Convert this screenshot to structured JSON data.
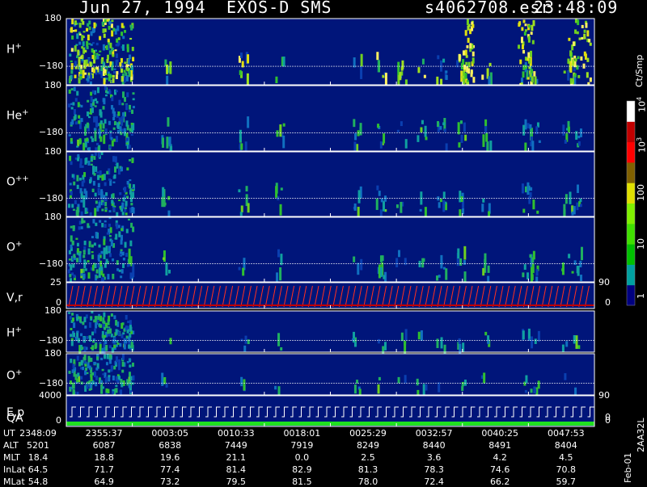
{
  "header": {
    "date": "Jun 27, 1994",
    "instrument": "EXOS-D SMS",
    "file": "s4062708.esr",
    "time": "23:48:09"
  },
  "chart_data": {
    "type": "heatmap",
    "colorbar": {
      "label": "Ct/Smp",
      "ticks": [
        "1",
        "10",
        "100",
        "10",
        "10"
      ],
      "tick_exponents": [
        "",
        "",
        "",
        "3",
        "4"
      ],
      "colors": [
        "#000080",
        "#00a0a0",
        "#00c000",
        "#40e000",
        "#80f000",
        "#e0e000",
        "#806000",
        "#ff0000",
        "#c00000",
        "#ffffff"
      ]
    },
    "panels": [
      {
        "id": "h_plus_1",
        "label": "H",
        "sup": "+",
        "ymax": "180",
        "ymin": "−180"
      },
      {
        "id": "he_plus",
        "label": "He",
        "sup": "+",
        "ymax": "180",
        "ymin": "−180"
      },
      {
        "id": "o_plusplus",
        "label": "O",
        "sup": "++",
        "ymax": "180",
        "ymin": "−180"
      },
      {
        "id": "o_plus_1",
        "label": "O",
        "sup": "+",
        "ymax": "180",
        "ymin": "−180"
      },
      {
        "id": "vr",
        "label": "V,r",
        "sup": "",
        "ymax": "25",
        "ymin": "0",
        "right_max": "90",
        "right_min": "0"
      },
      {
        "id": "h_plus_2",
        "label": "H",
        "sup": "+",
        "ymax": "180",
        "ymin": "−180"
      },
      {
        "id": "o_plus_2",
        "label": "O",
        "sup": "+",
        "ymax": "180",
        "ymin": "−180"
      },
      {
        "id": "ep",
        "label": "E,p",
        "sup": "",
        "ymax": "4000",
        "ymin": "0",
        "right_max": "90",
        "right_min": "0"
      }
    ],
    "qa_label": "QA",
    "qa_tick": "0",
    "table": {
      "rows": [
        {
          "label": "UT",
          "values": [
            "2348:09",
            "2355:37",
            "0003:05",
            "0010:33",
            "0018:01",
            "0025:29",
            "0032:57",
            "0040:25",
            "0047:53"
          ]
        },
        {
          "label": "ALT",
          "values": [
            "5201",
            "6087",
            "6838",
            "7449",
            "7919",
            "8249",
            "8440",
            "8491",
            "8404"
          ]
        },
        {
          "label": "MLT",
          "values": [
            "18.4",
            "18.8",
            "19.6",
            "21.1",
            "0.0",
            "2.5",
            "3.6",
            "4.2",
            "4.5"
          ]
        },
        {
          "label": "InLat",
          "values": [
            "64.5",
            "71.7",
            "77.4",
            "81.4",
            "82.9",
            "81.3",
            "78.3",
            "74.6",
            "70.8"
          ]
        },
        {
          "label": "MLat",
          "values": [
            "54.8",
            "64.9",
            "73.2",
            "79.5",
            "81.5",
            "78.0",
            "72.4",
            "66.2",
            "59.7"
          ]
        }
      ]
    }
  },
  "footer": {
    "date_code": "Feb-01",
    "version": "2AA32L"
  }
}
